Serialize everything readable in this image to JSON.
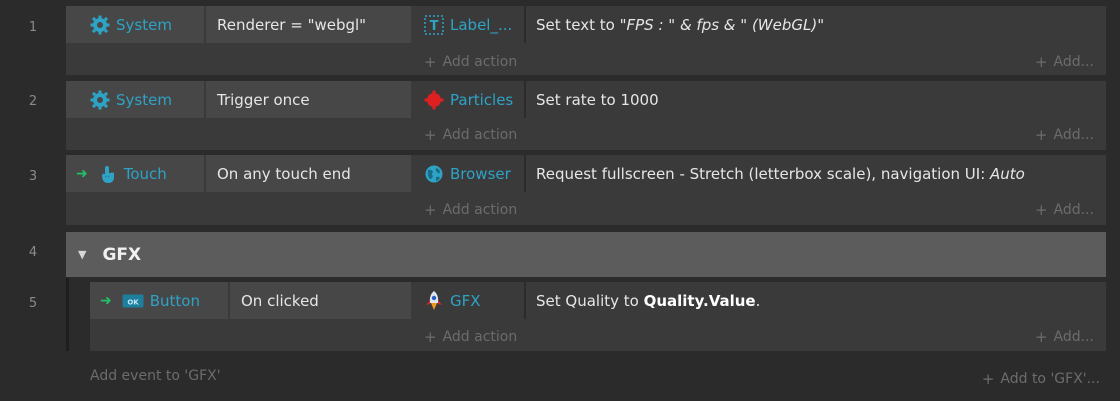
{
  "events": [
    {
      "number": "1",
      "condition": {
        "object": "System",
        "icon": "gear-icon",
        "text": "Renderer = \"webgl\"",
        "trigger": false
      },
      "action": {
        "object": "Label_...",
        "icon": "text-object-icon",
        "text_prefix": "Set text to ",
        "text_italic": "\"FPS : \" & fps & \" (WebGL)\""
      },
      "add_action": "Add action",
      "add_right": "Add..."
    },
    {
      "number": "2",
      "condition": {
        "object": "System",
        "icon": "gear-icon",
        "text": "Trigger once",
        "trigger": false
      },
      "action": {
        "object": "Particles",
        "icon": "particles-icon",
        "text_prefix": "Set rate to 1000"
      },
      "add_action": "Add action",
      "add_right": "Add..."
    },
    {
      "number": "3",
      "condition": {
        "object": "Touch",
        "icon": "touch-hand-icon",
        "text": "On any touch end",
        "trigger": true
      },
      "action": {
        "object": "Browser",
        "icon": "globe-icon",
        "text_prefix": "Request fullscreen - Stretch (letterbox scale), navigation UI: ",
        "text_italic": "Auto"
      },
      "add_action": "Add action",
      "add_right": "Add..."
    }
  ],
  "group": {
    "number": "4",
    "title": "GFX",
    "expand_icon": "triangle-down-icon"
  },
  "sub_event": {
    "number": "5",
    "condition": {
      "object": "Button",
      "icon": "button-object-icon",
      "text": "On clicked",
      "trigger": true
    },
    "action": {
      "object": "GFX",
      "icon": "rocket-icon",
      "text_prefix": "Set Quality to ",
      "text_bold": "Quality.Value",
      "text_suffix": "."
    },
    "add_action": "Add action",
    "add_right": "Add..."
  },
  "group_footer": {
    "add_event": "Add event to 'GFX'",
    "add_to": "Add to 'GFX'..."
  },
  "colors": {
    "background": "#2b2b2b",
    "event_bg": "#3a3a3a",
    "condition_bg": "#474747",
    "group_bg": "#5c5c5c",
    "object_name": "#2ea3c6",
    "trigger_arrow": "#1fc26a"
  }
}
